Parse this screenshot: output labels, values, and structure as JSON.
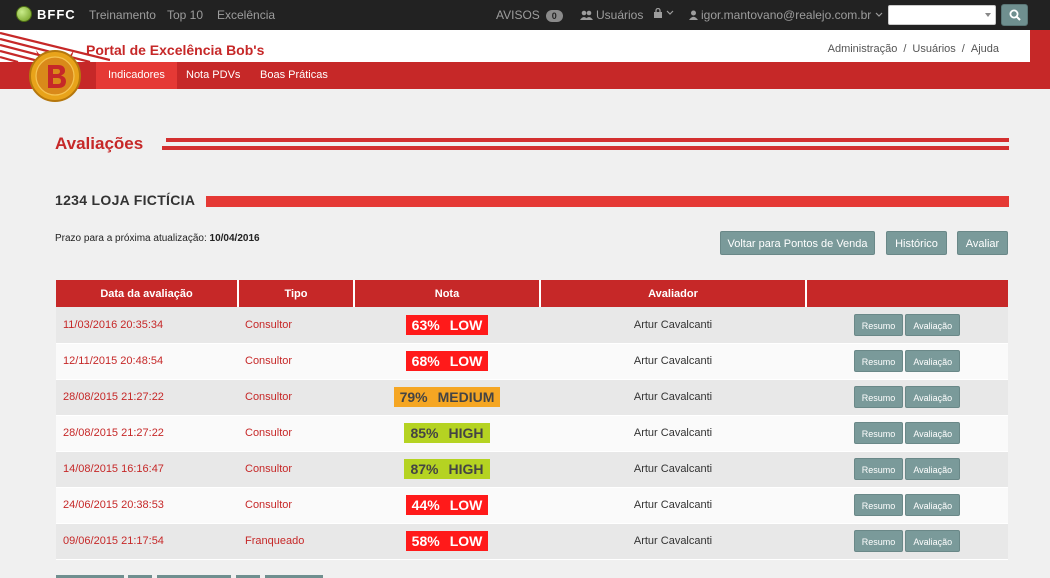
{
  "navbar": {
    "brand": "BFFC",
    "links": [
      "Treinamento",
      "Top 10",
      "Excelência"
    ],
    "avisos_label": "AVISOS",
    "avisos_count": "0",
    "usuarios_label": "Usuários",
    "user_email": "igor.mantovano@realejo.com.br",
    "search_value": ""
  },
  "header": {
    "title": "Portal de Excelência Bob's",
    "breadcrumb": [
      "Administração",
      "Usuários",
      "Ajuda"
    ],
    "subnav": [
      "Indicadores",
      "Nota PDVs",
      "Boas Práticas"
    ]
  },
  "page": {
    "section_title": "Avaliações",
    "store_title": "1234 LOJA FICTÍCIA",
    "deadline_label": "Prazo para a próxima atualização:",
    "deadline_value": "10/04/2016",
    "buttons": {
      "back": "Voltar para Pontos de Venda",
      "history": "Histórico",
      "evaluate": "Avaliar"
    }
  },
  "table": {
    "headers": [
      "Data da avaliação",
      "Tipo",
      "Nota",
      "Avaliador",
      ""
    ],
    "action_labels": [
      "Resumo",
      "Avaliação"
    ],
    "rows": [
      {
        "date": "11/03/2016 20:35:34",
        "type": "Consultor",
        "score": "63%",
        "level": "LOW",
        "evaluator": "Artur Cavalcanti"
      },
      {
        "date": "12/11/2015 20:48:54",
        "type": "Consultor",
        "score": "68%",
        "level": "LOW",
        "evaluator": "Artur Cavalcanti"
      },
      {
        "date": "28/08/2015 21:27:22",
        "type": "Consultor",
        "score": "79%",
        "level": "MEDIUM",
        "evaluator": "Artur Cavalcanti"
      },
      {
        "date": "28/08/2015 21:27:22",
        "type": "Consultor",
        "score": "85%",
        "level": "HIGH",
        "evaluator": "Artur Cavalcanti"
      },
      {
        "date": "14/08/2015 16:16:47",
        "type": "Consultor",
        "score": "87%",
        "level": "HIGH",
        "evaluator": "Artur Cavalcanti"
      },
      {
        "date": "24/06/2015 20:38:53",
        "type": "Consultor",
        "score": "44%",
        "level": "LOW",
        "evaluator": "Artur Cavalcanti"
      },
      {
        "date": "09/06/2015 21:17:54",
        "type": "Franqueado",
        "score": "58%",
        "level": "LOW",
        "evaluator": "Artur Cavalcanti"
      }
    ]
  },
  "colors": {
    "brand_red": "#c62828",
    "low": "#ff1a1a",
    "medium": "#f5a623",
    "high": "#b5d322"
  },
  "icons": {
    "users": "users-icon",
    "lock": "lock-icon",
    "user": "user-icon",
    "search": "search-icon"
  }
}
